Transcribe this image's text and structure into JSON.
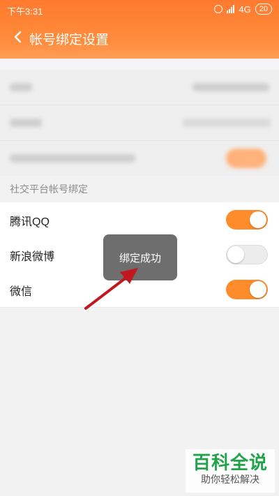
{
  "statusbar": {
    "time": "下午3:31",
    "network": "4G",
    "battery": "20"
  },
  "header": {
    "title": "帐号绑定设置",
    "back_icon": "back-arrow-icon"
  },
  "section": {
    "title": "社交平台帐号绑定"
  },
  "bindings": [
    {
      "label": "腾讯QQ",
      "enabled": true
    },
    {
      "label": "新浪微博",
      "enabled": false
    },
    {
      "label": "微信",
      "enabled": true
    }
  ],
  "toast": {
    "message": "绑定成功"
  },
  "watermark": {
    "title": "百科全说",
    "subtitle": "助你轻松解决"
  },
  "colors": {
    "accent": "#ff8c2a",
    "header_top": "#ff7a2e",
    "annotation_arrow": "#c0181e",
    "watermark_green": "#22a34a"
  }
}
